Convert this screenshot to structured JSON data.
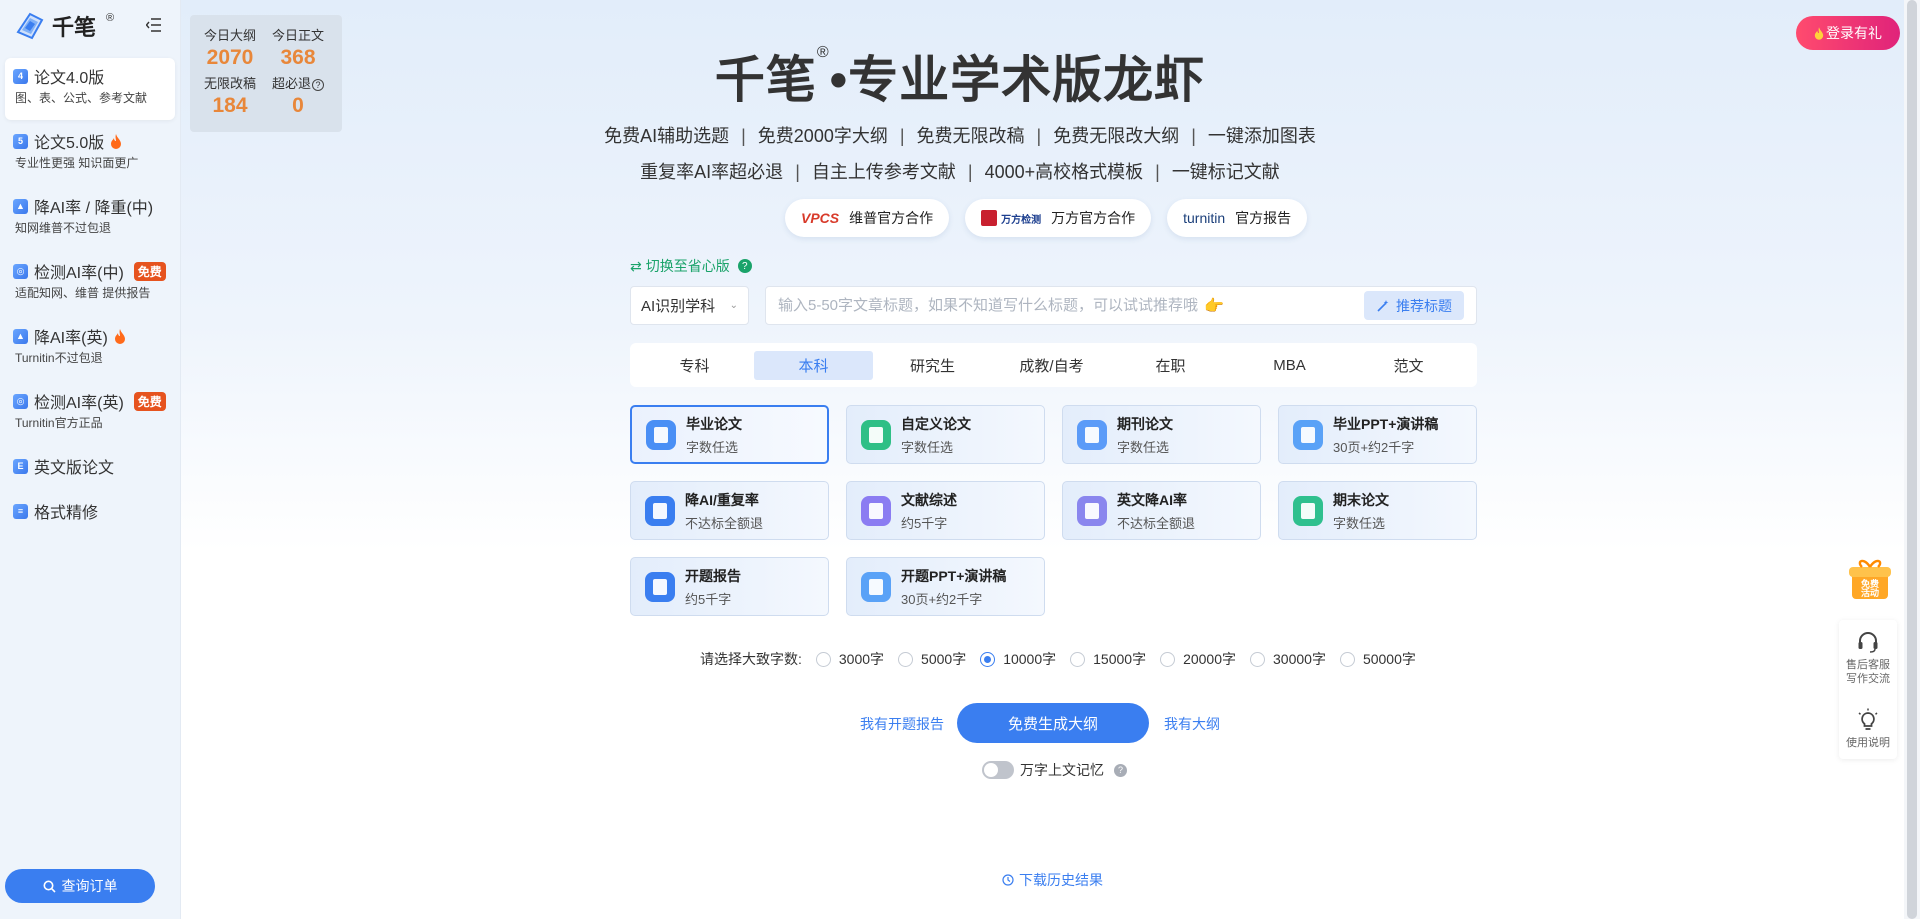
{
  "brand": {
    "name": "千笔",
    "reg": "®"
  },
  "sidebar": {
    "items": [
      {
        "label": "论文4.0版",
        "sub": "图、表、公式、参考文献",
        "icon": "4"
      },
      {
        "label": "论文5.0版",
        "sub": "专业性更强 知识面更广",
        "icon": "5"
      },
      {
        "label": "降AI率 / 降重(中)",
        "sub": "知网维普不过包退",
        "icon": ""
      },
      {
        "label": "检测AI率(中)",
        "sub": "适配知网、维普 提供报告",
        "icon": "",
        "badge": "免费"
      },
      {
        "label": "降AI率(英)",
        "sub": "Turnitin不过包退",
        "icon": ""
      },
      {
        "label": "检测AI率(英)",
        "sub": "Turnitin官方正品",
        "icon": "",
        "badge": "免费"
      },
      {
        "label": "英文版论文",
        "sub": "",
        "icon": ""
      },
      {
        "label": "格式精修",
        "sub": "",
        "icon": ""
      }
    ],
    "query_button": "查询订单"
  },
  "stats": [
    {
      "label": "今日大纲",
      "value": "2070"
    },
    {
      "label": "今日正文",
      "value": "368"
    },
    {
      "label": "无限改稿",
      "value": "184"
    },
    {
      "label": "超必退",
      "value": "0"
    }
  ],
  "header": {
    "title_a": "千笔",
    "title_reg": "®",
    "title_b": "•专业学术版龙虾",
    "features_line1": [
      "免费AI辅助选题",
      "免费2000字大纲",
      "免费无限改稿",
      "免费无限改大纲",
      "一键添加图表"
    ],
    "features_line2": [
      "重复率AI率超必退",
      "自主上传参考文献",
      "4000+高校格式模板",
      "一键标记文献"
    ],
    "sep": "|"
  },
  "partners": [
    {
      "logo": "VPCS",
      "label": "维普官方合作"
    },
    {
      "logo": "万方检测",
      "label": "万方官方合作"
    },
    {
      "logo": "turnitin",
      "label": "官方报告"
    }
  ],
  "switch_label": "切换至省心版",
  "subject": {
    "value": "AI识别学科"
  },
  "topic": {
    "placeholder": "输入5-50字文章标题，如果不知道写什么标题，可以试试推荐哦",
    "recommend": "推荐标题"
  },
  "tabs": [
    "专科",
    "本科",
    "研究生",
    "成教/自考",
    "在职",
    "MBA",
    "范文"
  ],
  "cards": [
    {
      "title": "毕业论文",
      "sub": "字数任选",
      "color": "#4a8ff5"
    },
    {
      "title": "自定义论文",
      "sub": "字数任选",
      "color": "#2fbf86"
    },
    {
      "title": "期刊论文",
      "sub": "字数任选",
      "color": "#5b9bf8"
    },
    {
      "title": "毕业PPT+演讲稿",
      "sub": "30页+约2千字",
      "color": "#5aa2f7"
    },
    {
      "title": "降AI/重复率",
      "sub": "不达标全额退",
      "color": "#3a7ef0"
    },
    {
      "title": "文献综述",
      "sub": "约5千字",
      "color": "#8b7cf2"
    },
    {
      "title": "英文降AI率",
      "sub": "不达标全额退",
      "color": "#8a86ee"
    },
    {
      "title": "期末论文",
      "sub": "字数任选",
      "color": "#2fc08e"
    },
    {
      "title": "开题报告",
      "sub": "约5千字",
      "color": "#3a7ef0"
    },
    {
      "title": "开题PPT+演讲稿",
      "sub": "30页+约2千字",
      "color": "#5aa2f7"
    }
  ],
  "word_count": {
    "label": "请选择大致字数:",
    "options": [
      "3000字",
      "5000字",
      "10000字",
      "15000字",
      "20000字",
      "30000字",
      "50000字"
    ],
    "selected": "10000字"
  },
  "actions": {
    "left_link": "我有开题报告",
    "generate": "免费生成大纲",
    "right_link": "我有大纲"
  },
  "memory": {
    "label": "万字上文记忆"
  },
  "history": "下载历史结果",
  "login": "登录有礼",
  "gift": {
    "label_line1": "免费",
    "label_line2": "活动"
  },
  "right_panel": {
    "service_line1": "售后客服",
    "service_line2": "写作交流",
    "guide": "使用说明"
  },
  "colors": {
    "accent": "#3a7ef0",
    "stat_orange": "#e8873a",
    "free_badge": "#e6531e",
    "green": "#1aa36a",
    "login_pink": "#e0237a"
  }
}
